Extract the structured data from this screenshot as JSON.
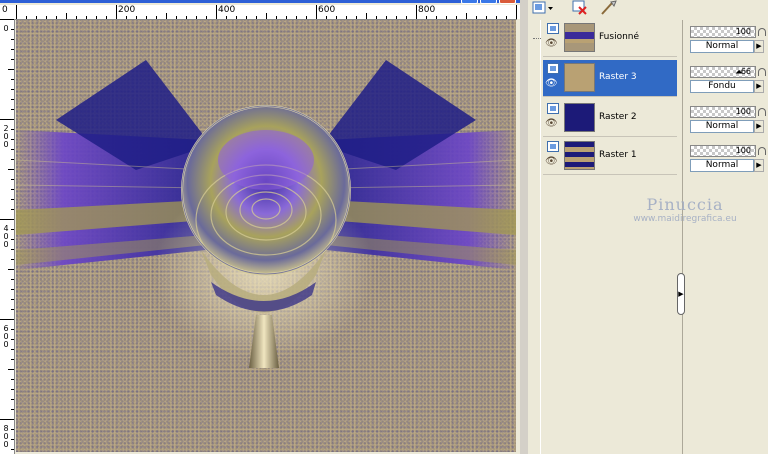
{
  "ruler": {
    "top_labels": [
      "0",
      "200",
      "400",
      "600",
      "800"
    ],
    "left_labels": [
      "0",
      "2\n0\n0",
      "4\n0\n0",
      "6\n0\n0",
      "8\n0\n0"
    ]
  },
  "layers": [
    {
      "name": "Fusionné",
      "selected": false,
      "opacity": "100",
      "blend": "Normal",
      "thumb": "fusion"
    },
    {
      "name": "Raster 3",
      "selected": true,
      "opacity": "66",
      "blend": "Fondu",
      "thumb": "#b9a173"
    },
    {
      "name": "Raster 2",
      "selected": false,
      "opacity": "100",
      "blend": "Normal",
      "thumb": "#1c1a78"
    },
    {
      "name": "Raster 1",
      "selected": false,
      "opacity": "100",
      "blend": "Normal",
      "thumb": "stripes"
    }
  ],
  "watermark": {
    "name": "Pinuccia",
    "url": "www.maidiregrafica.eu"
  },
  "icons": {
    "new-layer": "new-layer-icon",
    "delete-layer": "delete-layer-icon",
    "brush": "brush-icon",
    "visibility": "eye-icon",
    "collapse": "collapse-arrow-icon"
  },
  "colors": {
    "selection": "#316ac5",
    "canvas_bg": "#a89779",
    "purple": "#6a3fc1",
    "navy": "#1c1a78",
    "gold": "#b9a173"
  }
}
